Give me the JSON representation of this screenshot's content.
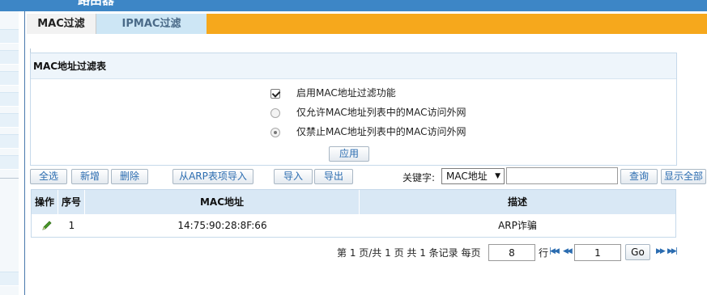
{
  "window": {
    "title": "路由器"
  },
  "tabs": [
    {
      "label": "MAC过滤",
      "active": true
    },
    {
      "label": "IPMAC过滤",
      "active": false
    }
  ],
  "panel": {
    "title": "MAC地址过滤表",
    "enable_checkbox": {
      "label": "启用MAC地址过滤功能",
      "checked": true
    },
    "radio_allow": {
      "label": "仅允许MAC地址列表中的MAC访问外网",
      "selected": false
    },
    "radio_deny": {
      "label": "仅禁止MAC地址列表中的MAC访问外网",
      "selected": true
    },
    "apply_label": "应用"
  },
  "toolbar": {
    "select_all": "全选",
    "add": "新增",
    "delete": "删除",
    "import_arp": "从ARP表项导入",
    "import": "导入",
    "export": "导出",
    "keyword_label": "关键字:",
    "keyword_select": "MAC地址",
    "keyword_input": "",
    "search": "查询",
    "show_all": "显示全部"
  },
  "table": {
    "columns": [
      "操作",
      "序号",
      "MAC地址",
      "描述"
    ],
    "rows": [
      {
        "index": "1",
        "mac": "14:75:90:28:8F:66",
        "desc": "ARP诈骗"
      }
    ]
  },
  "pager": {
    "text_pre": "第 1 页/共 1 页 共 1 条记录 每页",
    "per_page": "8",
    "text_row": "行",
    "page_input": "1",
    "go": "Go"
  },
  "colors": {
    "tab_bar": "#f6a81c",
    "header_bar": "#3d86c6",
    "table_header": "#d9e8f5",
    "link_text": "#2b6cb0"
  },
  "icons": {
    "edit": "pencil-icon",
    "first": "first-page-icon",
    "prev": "prev-page-icon",
    "next": "next-page-icon",
    "last": "last-page-icon"
  }
}
